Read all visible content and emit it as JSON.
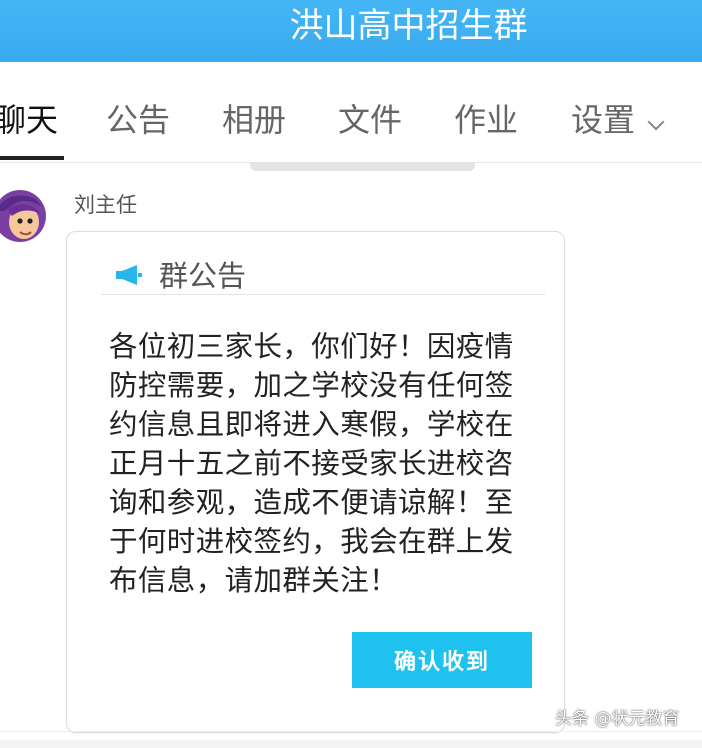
{
  "header": {
    "title": "洪山高中招生群"
  },
  "tabs": [
    {
      "label": "聊天",
      "active": true
    },
    {
      "label": "公告",
      "active": false
    },
    {
      "label": "相册",
      "active": false
    },
    {
      "label": "文件",
      "active": false
    },
    {
      "label": "作业",
      "active": false
    },
    {
      "label": "设置",
      "active": false
    }
  ],
  "chat": {
    "sender": "刘主任",
    "announcement": {
      "icon": "megaphone-icon",
      "title": "群公告",
      "body": "各位初三家长，你们好！因疫情防控需要，加之学校没有任何签约信息且即将进入寒假，学校在正月十五之前不接受家长进校咨询和参观，造成不便请谅解！至于何时进校签约，我会在群上发布信息，请加群关注！",
      "confirm_label": "确认收到"
    }
  },
  "watermark": "头条 @状元教育",
  "colors": {
    "header_bg": "#3aa9ee",
    "accent": "#1fc1ee",
    "icon": "#29b6e8"
  }
}
